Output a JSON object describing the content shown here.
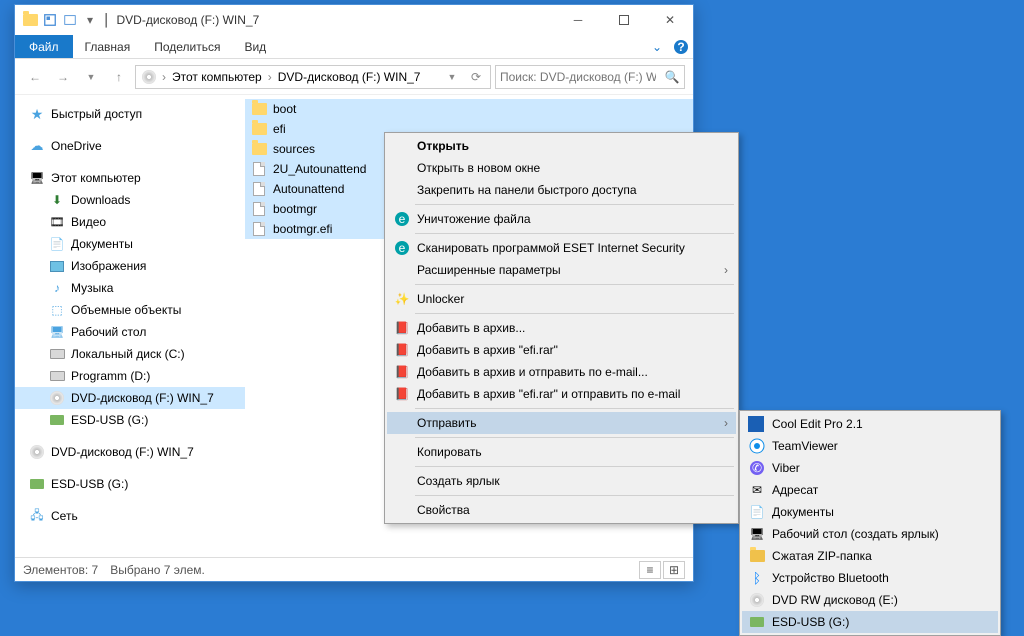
{
  "title": "DVD-дисковод (F:) WIN_7",
  "ribbon": {
    "file": "Файл",
    "tabs": [
      "Главная",
      "Поделиться",
      "Вид"
    ]
  },
  "address": {
    "root": "Этот компьютер",
    "loc": "DVD-дисковод (F:) WIN_7"
  },
  "search": {
    "placeholder": "Поиск: DVD-дисковод (F:) WI..."
  },
  "sidebar": {
    "quick": "Быстрый доступ",
    "onedrive": "OneDrive",
    "thispc": "Этот компьютер",
    "items": [
      "Downloads",
      "Видео",
      "Документы",
      "Изображения",
      "Музыка",
      "Объемные объекты",
      "Рабочий стол",
      "Локальный диск (C:)",
      "Programm (D:)",
      "DVD-дисковод (F:) WIN_7",
      "ESD-USB (G:)"
    ],
    "dvd2": "DVD-дисковод (F:) WIN_7",
    "esd2": "ESD-USB (G:)",
    "network": "Сеть"
  },
  "files": [
    {
      "name": "boot",
      "type": "folder"
    },
    {
      "name": "efi",
      "type": "folder"
    },
    {
      "name": "sources",
      "type": "folder"
    },
    {
      "name": "2U_Autounattend",
      "type": "file"
    },
    {
      "name": "Autounattend",
      "type": "file"
    },
    {
      "name": "bootmgr",
      "type": "file"
    },
    {
      "name": "bootmgr.efi",
      "type": "file"
    }
  ],
  "status": {
    "count": "Элементов: 7",
    "sel": "Выбрано 7 элем."
  },
  "cm1": {
    "open": "Открыть",
    "openwin": "Открыть в новом окне",
    "pin": "Закрепить на панели быстрого доступа",
    "destroy": "Уничтожение файла",
    "scan": "Сканировать программой ESET Internet Security",
    "advanced": "Расширенные параметры",
    "unlocker": "Unlocker",
    "rar1": "Добавить в архив...",
    "rar2": "Добавить в архив \"efi.rar\"",
    "rar3": "Добавить в архив и отправить по e-mail...",
    "rar4": "Добавить в архив \"efi.rar\" и отправить по e-mail",
    "send": "Отправить",
    "copy": "Копировать",
    "shortcut": "Создать ярлык",
    "props": "Свойства"
  },
  "cm2": {
    "items": [
      "Cool Edit Pro 2.1",
      "TeamViewer",
      "Viber",
      "Адресат",
      "Документы",
      "Рабочий стол (создать ярлык)",
      "Сжатая ZIP-папка",
      "Устройство Bluetooth",
      "DVD RW дисковод (E:)",
      "ESD-USB (G:)"
    ]
  }
}
